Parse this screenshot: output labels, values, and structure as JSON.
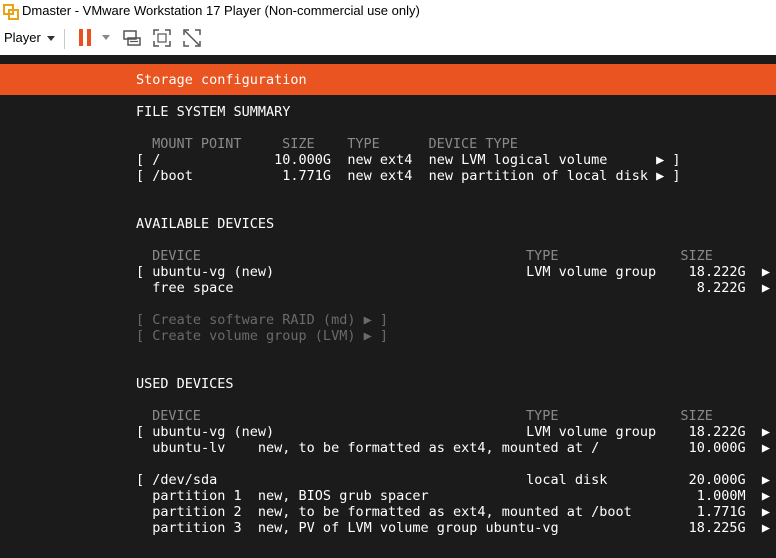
{
  "window": {
    "title": "Dmaster - VMware Workstation 17 Player (Non-commercial use only)"
  },
  "toolbar": {
    "player_label": "Player"
  },
  "installer": {
    "header": "Storage configuration",
    "fs_summary": {
      "heading": "FILE SYSTEM SUMMARY",
      "columns": " MOUNT POINT     SIZE    TYPE      DEVICE TYPE",
      "rows": [
        "[ /              10.000G  new ext4  new LVM logical volume      ▶ ]",
        "[ /boot           1.771G  new ext4  new partition of local disk ▶ ]"
      ]
    },
    "available": {
      "heading": "AVAILABLE DEVICES",
      "columns": " DEVICE                                        TYPE               SIZE",
      "rows": [
        "[ ubuntu-vg (new)                               LVM volume group    18.222G  ▶ ]",
        "  free space                                                         8.222G  ▶"
      ],
      "actions": [
        "[ Create software RAID (md) ▶ ]",
        "[ Create volume group (LVM) ▶ ]"
      ]
    },
    "used": {
      "heading": "USED DEVICES",
      "columns": " DEVICE                                        TYPE               SIZE",
      "rows": [
        "[ ubuntu-vg (new)                               LVM volume group    18.222G  ▶ ]",
        "  ubuntu-lv    new, to be formatted as ext4, mounted at /           10.000G  ▶",
        "[ /dev/sda                                      local disk          20.000G  ▶ ]",
        "  partition 1  new, BIOS grub spacer                                 1.000M  ▶",
        "  partition 2  new, to be formatted as ext4, mounted at /boot        1.771G  ▶",
        "  partition 3  new, PV of LVM volume group ubuntu-vg                18.225G  ▶"
      ]
    }
  }
}
